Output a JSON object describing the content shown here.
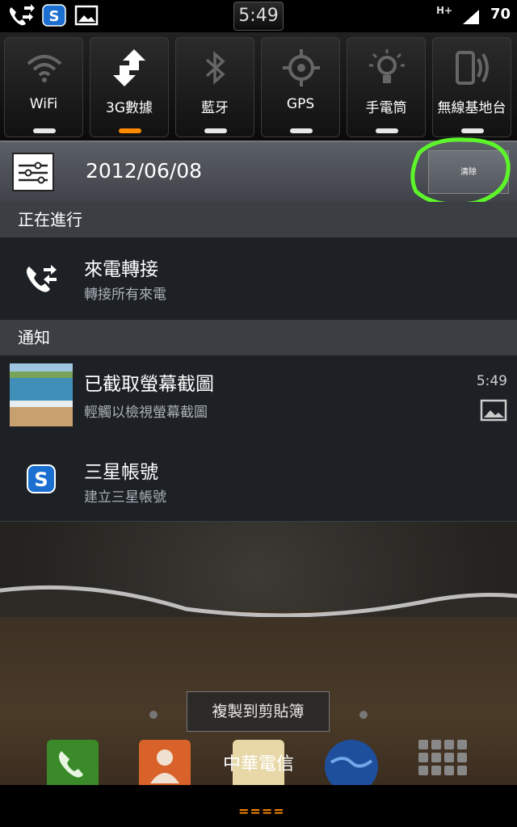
{
  "status_bar": {
    "time": "5:49",
    "network": "H+",
    "battery": "70",
    "left_icons": [
      "phone-forward-icon",
      "samsung-account-icon",
      "image-icon"
    ]
  },
  "quick_settings": [
    {
      "label": "WiFi",
      "icon": "wifi-icon",
      "on": false
    },
    {
      "label": "3G數據",
      "icon": "data-transfer-icon",
      "on": true
    },
    {
      "label": "藍牙",
      "icon": "bluetooth-icon",
      "on": false
    },
    {
      "label": "GPS",
      "icon": "gps-icon",
      "on": false
    },
    {
      "label": "手電筒",
      "icon": "flashlight-icon",
      "on": false
    },
    {
      "label": "無線基地台",
      "icon": "hotspot-icon",
      "on": false
    }
  ],
  "header": {
    "date": "2012/06/08",
    "clear_label": "清除"
  },
  "sections": {
    "ongoing": "正在進行",
    "notifications": "通知"
  },
  "ongoing": {
    "title": "來電轉接",
    "subtitle": "轉接所有來電"
  },
  "notifications": [
    {
      "title": "已截取螢幕截圖",
      "subtitle": "輕觸以檢視螢幕截圖",
      "time": "5:49"
    },
    {
      "title": "三星帳號",
      "subtitle": "建立三星帳號"
    }
  ],
  "home": {
    "copy_to_clipboard": "複製到剪貼簿",
    "carrier": "中華電信",
    "handle": "===="
  },
  "colors": {
    "accent": "#ff8a00",
    "highlight": "#5cf52a"
  }
}
